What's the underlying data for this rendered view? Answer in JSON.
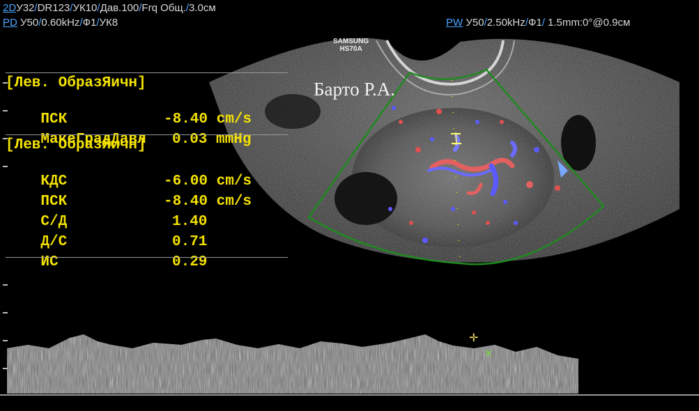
{
  "header": {
    "line1": {
      "mode": "2D",
      "params": [
        "У32",
        "DR123",
        "УК10",
        "Дав.100",
        "Frq Общ.",
        "3.0см"
      ]
    },
    "line2": {
      "mode": "PD",
      "params": [
        "У50",
        "0.60kHz",
        "Ф1",
        "УК8"
      ]
    },
    "line3": {
      "mode": "PW",
      "params": [
        "У50",
        "2.50kHz",
        "Ф1",
        " 1.5mm:0°@0.9см"
      ]
    }
  },
  "device": {
    "brand": "SAMSUNG",
    "model": "HS70A"
  },
  "signature": "Барто Р.А.",
  "measurements": {
    "group1": {
      "title": "[Лев. ОбразЯичн]",
      "rows": [
        {
          "label": "ПСК",
          "value": "-8.40 cm/s"
        },
        {
          "label": "МаксГрадДавл",
          "value": "0.03 mmHg"
        }
      ]
    },
    "group2": {
      "title": "[Лев. ОбразЯичн]",
      "rows": [
        {
          "label": "КДС",
          "value": "-6.00 cm/s"
        },
        {
          "label": "ПСК",
          "value": "-8.40 cm/s"
        },
        {
          "label": "С/Д",
          "value": "1.40"
        },
        {
          "label": "Д/С",
          "value": "0.71"
        },
        {
          "label": "ИС",
          "value": "0.29"
        }
      ]
    }
  },
  "colors": {
    "measure_text": "#f4e200",
    "mode_label": "#4aa3ff",
    "roi_box": "#1f8a1f"
  },
  "icons": [
    "plus-cursor-icon",
    "cross-cursor-icon"
  ]
}
